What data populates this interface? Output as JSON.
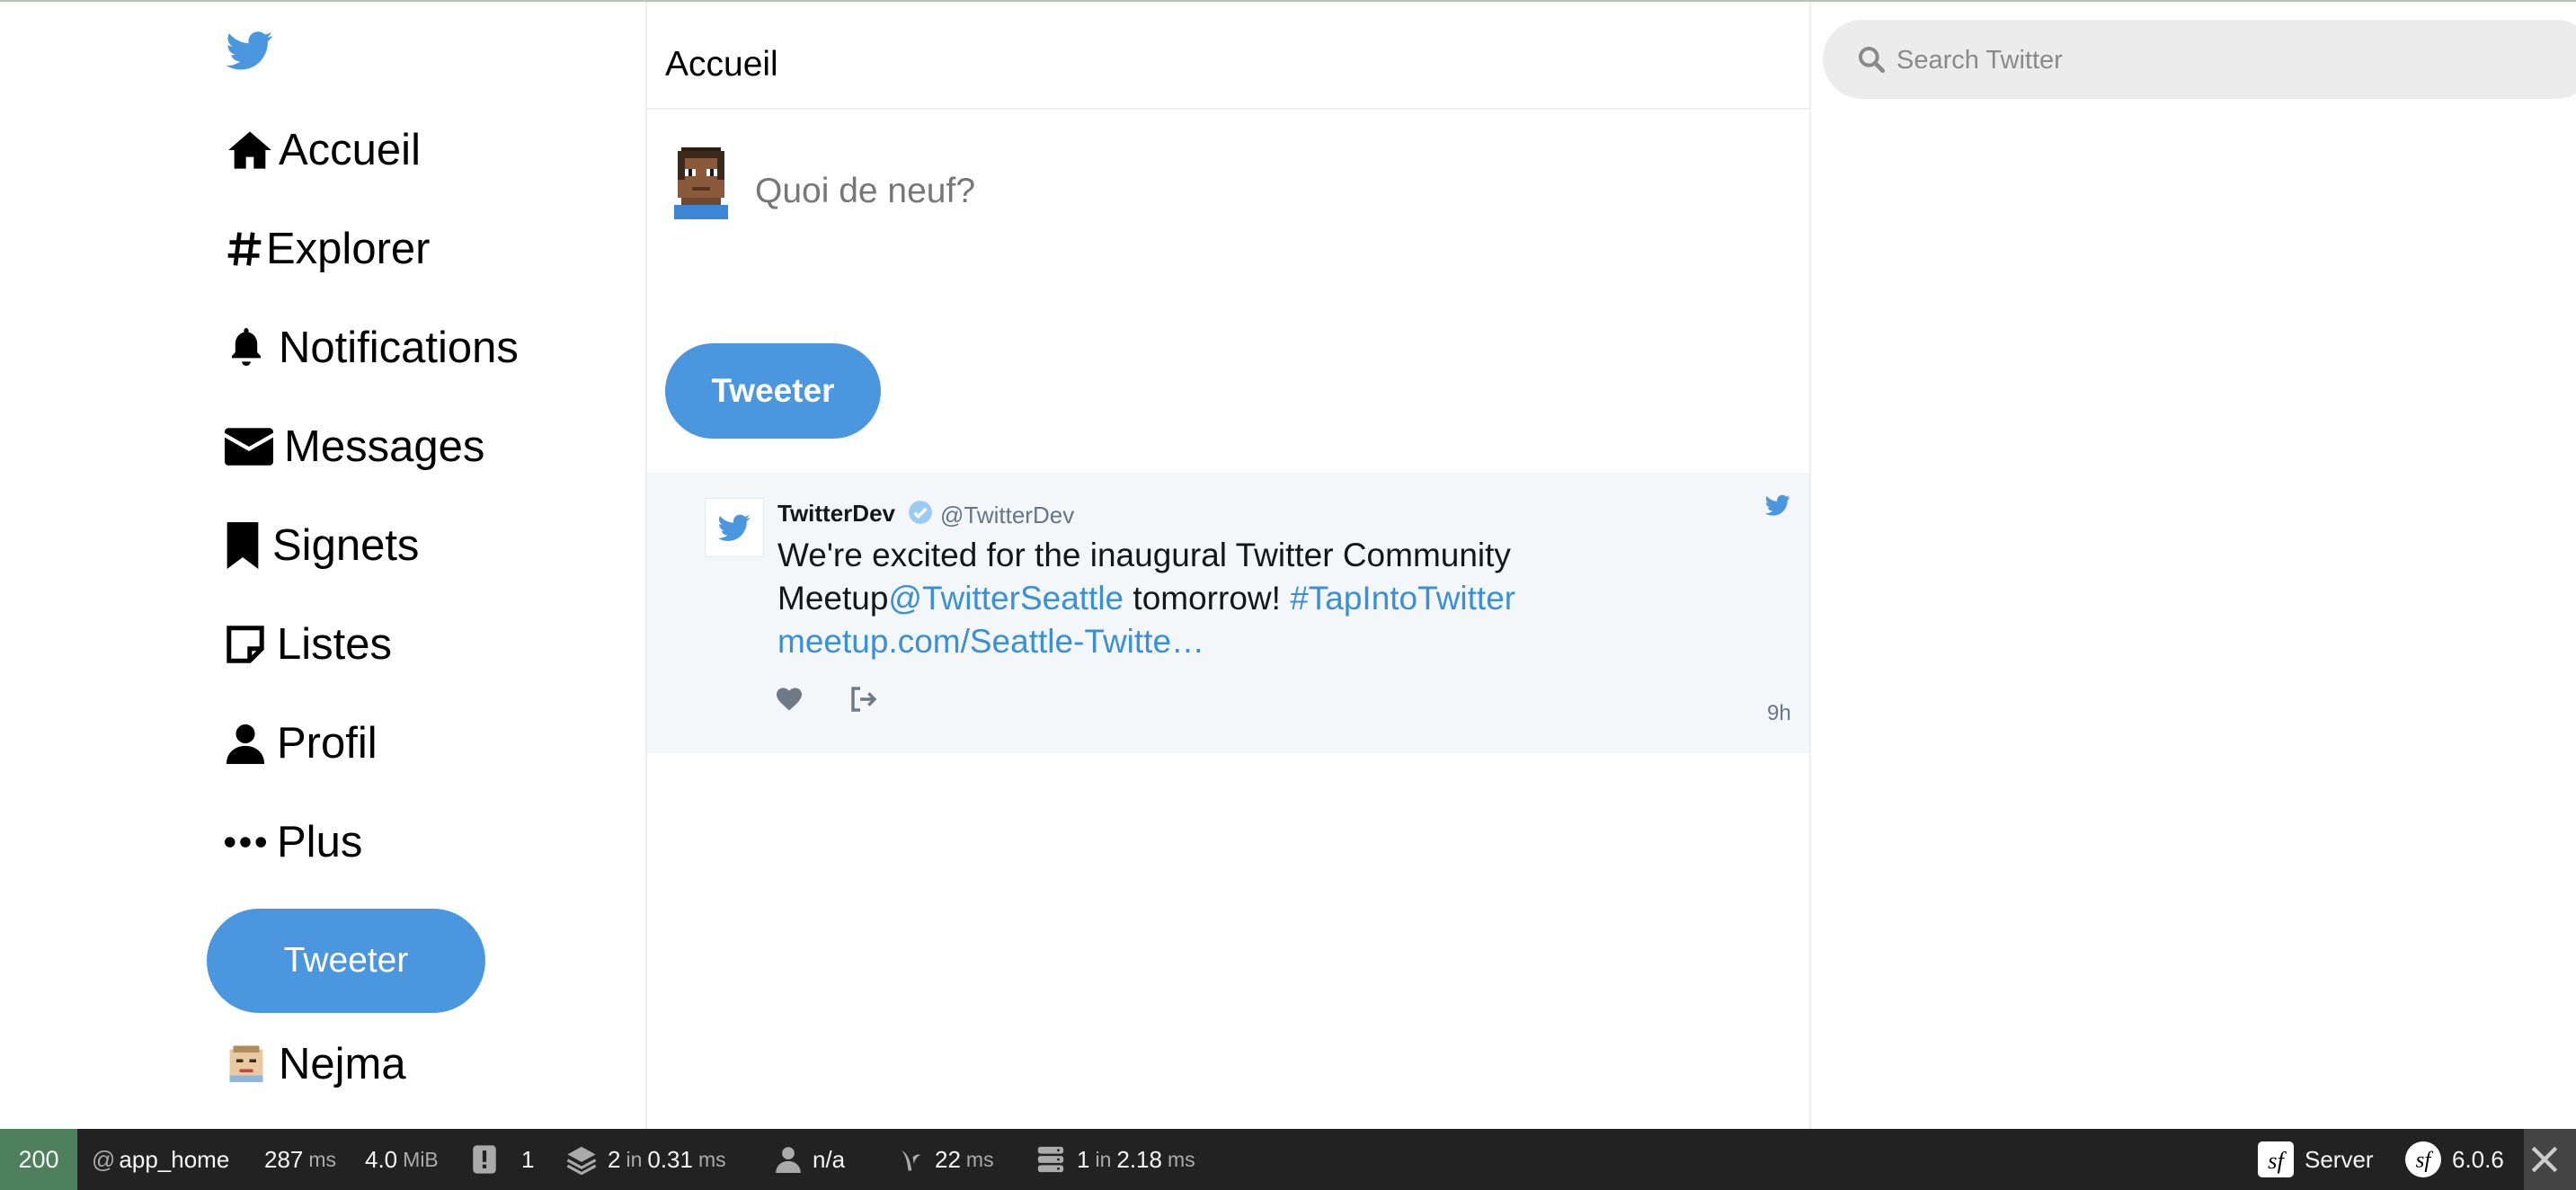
{
  "colors": {
    "accent": "#4a97df",
    "link": "#3b8fd6",
    "toolbar_bg": "#222222",
    "status_ok": "#4f805d",
    "tweet_card_bg": "#f4f7fa"
  },
  "sidebar": {
    "logo_icon": "twitter-bird-icon",
    "items": [
      {
        "label": "Accueil",
        "icon": "home-icon"
      },
      {
        "label": "Explorer",
        "icon": "hashtag-icon"
      },
      {
        "label": "Notifications",
        "icon": "bell-icon"
      },
      {
        "label": "Messages",
        "icon": "envelope-icon"
      },
      {
        "label": "Signets",
        "icon": "bookmark-icon"
      },
      {
        "label": "Listes",
        "icon": "list-icon"
      },
      {
        "label": "Profil",
        "icon": "user-icon"
      },
      {
        "label": "Plus",
        "icon": "more-icon"
      }
    ],
    "tweet_button": "Tweeter",
    "user_name": "Nejma"
  },
  "main": {
    "title": "Accueil",
    "compose_placeholder": "Quoi de neuf?",
    "tweet_button": "Tweeter",
    "tweet": {
      "author_name": "TwitterDev",
      "author_handle": "@TwitterDev",
      "text_before": "We're excited for the inaugural Twitter Community Meetup",
      "mention": "@TwitterSeattle",
      "text_middle": " tomorrow! ",
      "hashtag": "#TapIntoTwitter",
      "link": "meetup.com/Seattle-Twitte…",
      "time": "9h"
    }
  },
  "search": {
    "placeholder": "Search Twitter"
  },
  "debug_toolbar": {
    "status_code": "200",
    "route": "app_home",
    "time_value": "287",
    "time_unit": "ms",
    "memory_value": "4.0",
    "memory_unit": "MiB",
    "logs_count": "1",
    "cache_count": "2",
    "cache_in": "in",
    "cache_time": "0.31",
    "cache_unit": "ms",
    "user": "n/a",
    "twig_time": "22",
    "twig_unit": "ms",
    "db_count": "1",
    "db_in": "in",
    "db_time": "2.18",
    "db_unit": "ms",
    "server_label": "Server",
    "symfony_version": "6.0.6"
  }
}
